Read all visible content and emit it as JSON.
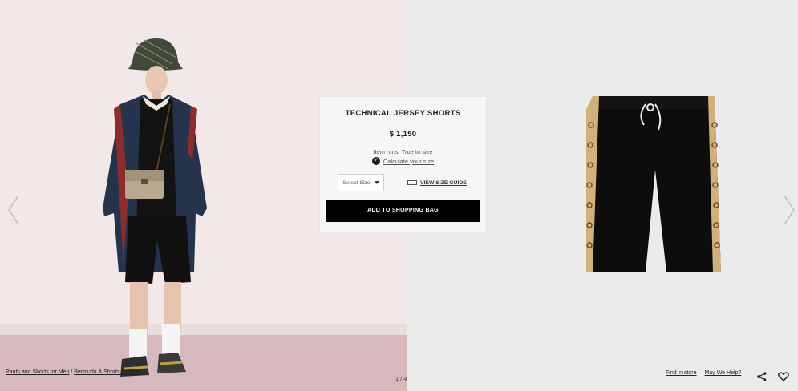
{
  "product": {
    "title": "TECHNICAL JERSEY SHORTS",
    "price": "$ 1,150",
    "fit_note": "Item runs: True to size",
    "calc_link": "Calculate your size",
    "size_select": "Select Size",
    "size_guide": "VIEW SIZE GUIDE",
    "add_button": "ADD TO SHOPPING BAG"
  },
  "breadcrumb": {
    "item1": "Pants and Shorts for Men",
    "separator": "/",
    "item2": "Bermuda & Shorts for Men"
  },
  "pager": "1 / 4",
  "footer": {
    "find_in_store": "Find in store",
    "help": "May We Help?"
  },
  "icons": {
    "prev": "chevron-left-icon",
    "next": "chevron-right-icon",
    "share": "share-icon",
    "wishlist": "heart-icon",
    "calculator": "calculator-icon",
    "ruler": "ruler-icon"
  },
  "colors": {
    "button_bg": "#000000",
    "card_bg": "#f6f6f6",
    "left_bg": "#f1e8e7",
    "right_bg": "#ebebeb"
  }
}
